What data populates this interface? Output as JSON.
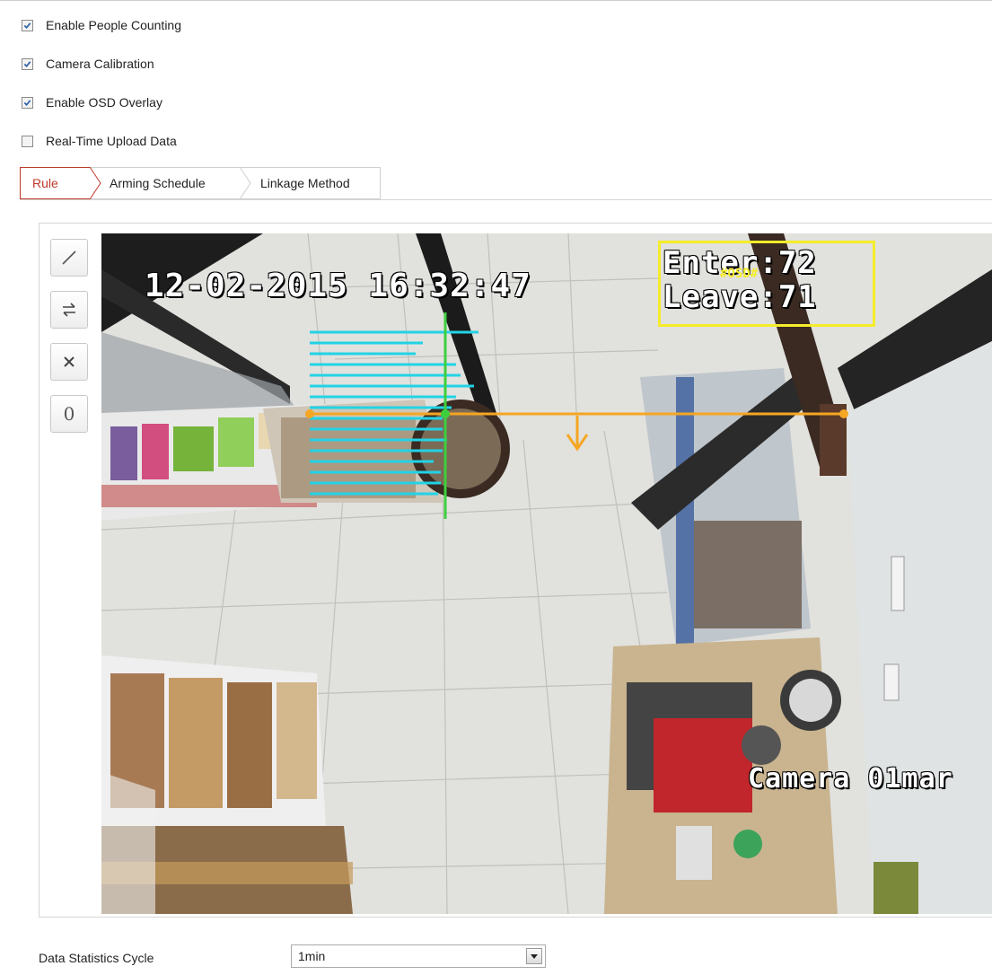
{
  "options": [
    {
      "label": "Enable People Counting",
      "checked": true
    },
    {
      "label": "Camera Calibration",
      "checked": true
    },
    {
      "label": "Enable OSD Overlay",
      "checked": true
    },
    {
      "label": "Real-Time Upload Data",
      "checked": false
    }
  ],
  "tabs": [
    {
      "label": "Rule",
      "active": true
    },
    {
      "label": "Arming Schedule",
      "active": false
    },
    {
      "label": "Linkage Method",
      "active": false
    }
  ],
  "toolbar": [
    {
      "icon": "draw-line-icon"
    },
    {
      "icon": "swap-direction-icon"
    },
    {
      "icon": "close-icon"
    },
    {
      "icon": "zero-icon",
      "label": "0"
    }
  ],
  "video": {
    "datetime": "12-02-2015 16:32:47",
    "enter_label": "Enter:72",
    "leave_label": "Leave:71",
    "osd_tag": "#OSD#",
    "camera_name": "Camera 01mar"
  },
  "colors": {
    "active_tab": "#c0392b",
    "count_line": "#f5a623",
    "calibration_lines": "#22d3e6",
    "calibration_vertical": "#3ecf3e",
    "osd_box": "#f5ec2a"
  },
  "form": {
    "statistics_cycle_label": "Data Statistics Cycle",
    "statistics_cycle_value": "1min"
  }
}
